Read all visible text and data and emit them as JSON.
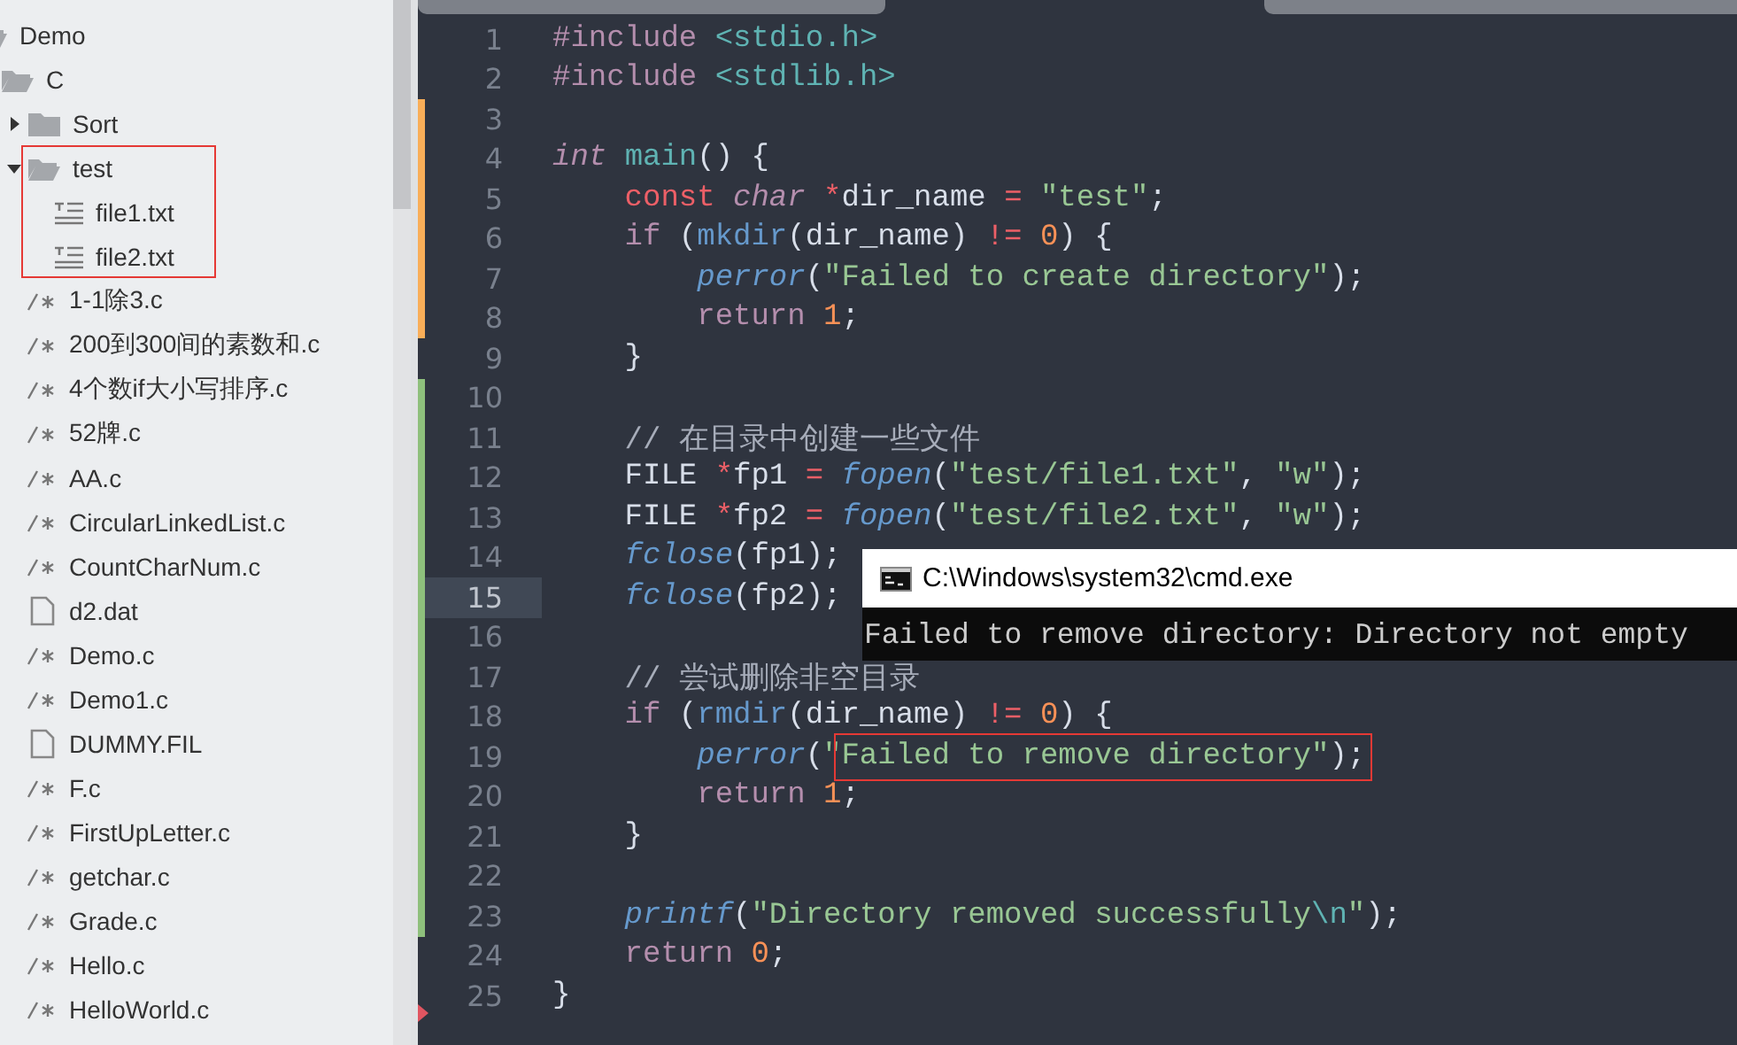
{
  "sidebar": {
    "tree": [
      {
        "name": "Demo",
        "kind": "folder",
        "children": [
          {
            "name": "C",
            "kind": "folder",
            "expanded": true,
            "children": [
              {
                "name": "Sort",
                "kind": "folder",
                "expanded": false
              },
              {
                "name": "test",
                "kind": "folder",
                "expanded": true,
                "boxed": true,
                "children": [
                  {
                    "name": "file1.txt",
                    "kind": "text"
                  },
                  {
                    "name": "file2.txt",
                    "kind": "text"
                  }
                ]
              },
              {
                "name": "1-1除3.c",
                "kind": "c"
              },
              {
                "name": "200到300间的素数和.c",
                "kind": "c"
              },
              {
                "name": "4个数if大小写排序.c",
                "kind": "c"
              },
              {
                "name": "52牌.c",
                "kind": "c"
              },
              {
                "name": "AA.c",
                "kind": "c"
              },
              {
                "name": "CircularLinkedList.c",
                "kind": "c"
              },
              {
                "name": "CountCharNum.c",
                "kind": "c"
              },
              {
                "name": "d2.dat",
                "kind": "file"
              },
              {
                "name": "Demo.c",
                "kind": "c"
              },
              {
                "name": "Demo1.c",
                "kind": "c"
              },
              {
                "name": "DUMMY.FIL",
                "kind": "file"
              },
              {
                "name": "F.c",
                "kind": "c"
              },
              {
                "name": "FirstUpLetter.c",
                "kind": "c"
              },
              {
                "name": "getchar.c",
                "kind": "c"
              },
              {
                "name": "Grade.c",
                "kind": "c"
              },
              {
                "name": "Hello.c",
                "kind": "c"
              },
              {
                "name": "HelloWorld.c",
                "kind": "c"
              }
            ]
          }
        ]
      }
    ]
  },
  "editor": {
    "lines": [
      {
        "number": "1",
        "current": false,
        "tokens": [
          {
            "kind": "pp",
            "text": "#include "
          },
          {
            "kind": "inc",
            "text": "<stdio.h>"
          }
        ]
      },
      {
        "number": "2",
        "current": false,
        "tokens": [
          {
            "kind": "pp",
            "text": "#include "
          },
          {
            "kind": "inc",
            "text": "<stdlib.h>"
          }
        ]
      },
      {
        "number": "3",
        "color": "#f9ae58",
        "current": false
      },
      {
        "number": "4",
        "color": "#f9ae58",
        "current": false,
        "tokens": [
          {
            "kind": "type",
            "text": "int "
          },
          {
            "kind": "def",
            "text": "main"
          },
          {
            "kind": "plain",
            "text": "() {"
          }
        ]
      },
      {
        "number": "5",
        "color": "#f9ae58",
        "current": false,
        "tokens": [
          {
            "kind": "kw",
            "text": "    const "
          },
          {
            "kind": "type",
            "text": "char "
          },
          {
            "kind": "op",
            "text": "*"
          },
          {
            "kind": "plain",
            "text": "dir_name "
          },
          {
            "kind": "op",
            "text": "= "
          },
          {
            "kind": "str",
            "text": "\"test\""
          },
          {
            "kind": "plain",
            "text": ";"
          }
        ]
      },
      {
        "number": "6",
        "color": "#f9ae58",
        "current": false,
        "tokens": [
          {
            "kind": "ctl",
            "text": "    if "
          },
          {
            "kind": "plain",
            "text": "("
          },
          {
            "kind": "call",
            "text": "mkdir"
          },
          {
            "kind": "plain",
            "text": "(dir_name) "
          },
          {
            "kind": "op",
            "text": "!= "
          },
          {
            "kind": "num",
            "text": "0"
          },
          {
            "kind": "plain",
            "text": ") {"
          }
        ]
      },
      {
        "number": "7",
        "color": "#f9ae58",
        "current": false,
        "tokens": [
          {
            "kind": "lib",
            "text": "        perror"
          },
          {
            "kind": "plain",
            "text": "("
          },
          {
            "kind": "str",
            "text": "\"Failed to create directory\""
          },
          {
            "kind": "plain",
            "text": ");"
          }
        ]
      },
      {
        "number": "8",
        "color": "#f9ae58",
        "current": false,
        "tokens": [
          {
            "kind": "ctl",
            "text": "        return "
          },
          {
            "kind": "num",
            "text": "1"
          },
          {
            "kind": "plain",
            "text": ";"
          }
        ]
      },
      {
        "number": "9",
        "current": false,
        "tokens": [
          {
            "kind": "plain",
            "text": "    }"
          }
        ]
      },
      {
        "number": "10",
        "color": "#8ec07c",
        "current": false
      },
      {
        "number": "11",
        "color": "#8ec07c",
        "current": false,
        "tokens": [
          {
            "kind": "comment",
            "text": "    // 在目录中创建一些文件"
          }
        ]
      },
      {
        "number": "12",
        "color": "#8ec07c",
        "current": false,
        "tokens": [
          {
            "kind": "plain",
            "text": "    FILE "
          },
          {
            "kind": "op",
            "text": "*"
          },
          {
            "kind": "plain",
            "text": "fp1 "
          },
          {
            "kind": "op",
            "text": "= "
          },
          {
            "kind": "lib",
            "text": "fopen"
          },
          {
            "kind": "plain",
            "text": "("
          },
          {
            "kind": "str",
            "text": "\"test/file1.txt\""
          },
          {
            "kind": "plain",
            "text": ", "
          },
          {
            "kind": "str",
            "text": "\"w\""
          },
          {
            "kind": "plain",
            "text": ");"
          }
        ]
      },
      {
        "number": "13",
        "color": "#8ec07c",
        "current": false,
        "tokens": [
          {
            "kind": "plain",
            "text": "    FILE "
          },
          {
            "kind": "op",
            "text": "*"
          },
          {
            "kind": "plain",
            "text": "fp2 "
          },
          {
            "kind": "op",
            "text": "= "
          },
          {
            "kind": "lib",
            "text": "fopen"
          },
          {
            "kind": "plain",
            "text": "("
          },
          {
            "kind": "str",
            "text": "\"test/file2.txt\""
          },
          {
            "kind": "plain",
            "text": ", "
          },
          {
            "kind": "str",
            "text": "\"w\""
          },
          {
            "kind": "plain",
            "text": ");"
          }
        ]
      },
      {
        "number": "14",
        "color": "#8ec07c",
        "current": false,
        "tokens": [
          {
            "kind": "lib",
            "text": "    fclose"
          },
          {
            "kind": "plain",
            "text": "(fp1);"
          }
        ]
      },
      {
        "number": "15",
        "color": "#8ec07c",
        "current": true,
        "tokens": [
          {
            "kind": "lib",
            "text": "    fclose"
          },
          {
            "kind": "plain",
            "text": "(fp2);"
          }
        ]
      },
      {
        "number": "16",
        "color": "#8ec07c",
        "current": false
      },
      {
        "number": "17",
        "color": "#8ec07c",
        "current": false,
        "tokens": [
          {
            "kind": "comment",
            "text": "    // 尝试删除非空目录"
          }
        ]
      },
      {
        "number": "18",
        "color": "#8ec07c",
        "current": false,
        "tokens": [
          {
            "kind": "ctl",
            "text": "    if "
          },
          {
            "kind": "plain",
            "text": "("
          },
          {
            "kind": "call",
            "text": "rmdir"
          },
          {
            "kind": "plain",
            "text": "(dir_name) "
          },
          {
            "kind": "op",
            "text": "!= "
          },
          {
            "kind": "num",
            "text": "0"
          },
          {
            "kind": "plain",
            "text": ") {"
          }
        ]
      },
      {
        "number": "19",
        "color": "#8ec07c",
        "current": false,
        "tokens": [
          {
            "kind": "lib",
            "text": "        perror"
          },
          {
            "kind": "plain",
            "text": "("
          },
          {
            "kind": "str",
            "text": "\""
          }
        ],
        "boxed_tokens": [
          {
            "kind": "str",
            "text": "Failed to remove directory\""
          },
          {
            "kind": "plain",
            "text": ");"
          }
        ]
      },
      {
        "number": "20",
        "color": "#8ec07c",
        "current": false,
        "tokens": [
          {
            "kind": "ctl",
            "text": "        return "
          },
          {
            "kind": "num",
            "text": "1"
          },
          {
            "kind": "plain",
            "text": ";"
          }
        ]
      },
      {
        "number": "21",
        "color": "#8ec07c",
        "current": false,
        "tokens": [
          {
            "kind": "plain",
            "text": "    }"
          }
        ]
      },
      {
        "number": "22",
        "color": "#8ec07c",
        "current": false
      },
      {
        "number": "23",
        "color": "#8ec07c",
        "current": false,
        "tokens": [
          {
            "kind": "lib",
            "text": "    printf"
          },
          {
            "kind": "plain",
            "text": "("
          },
          {
            "kind": "str",
            "text": "\"Directory removed successfully"
          },
          {
            "kind": "esc",
            "text": "\\n"
          },
          {
            "kind": "str",
            "text": "\""
          },
          {
            "kind": "plain",
            "text": ");"
          }
        ]
      },
      {
        "number": "24",
        "current": false,
        "tokens": [
          {
            "kind": "ctl",
            "text": "    return "
          },
          {
            "kind": "num",
            "text": "0"
          },
          {
            "kind": "plain",
            "text": ";"
          }
        ]
      },
      {
        "number": "25",
        "current": false,
        "tokens": [
          {
            "kind": "plain",
            "text": "}"
          }
        ]
      }
    ]
  },
  "console": {
    "title": "C:\\Windows\\system32\\cmd.exe",
    "output": "Failed to remove directory: Directory not empty"
  }
}
